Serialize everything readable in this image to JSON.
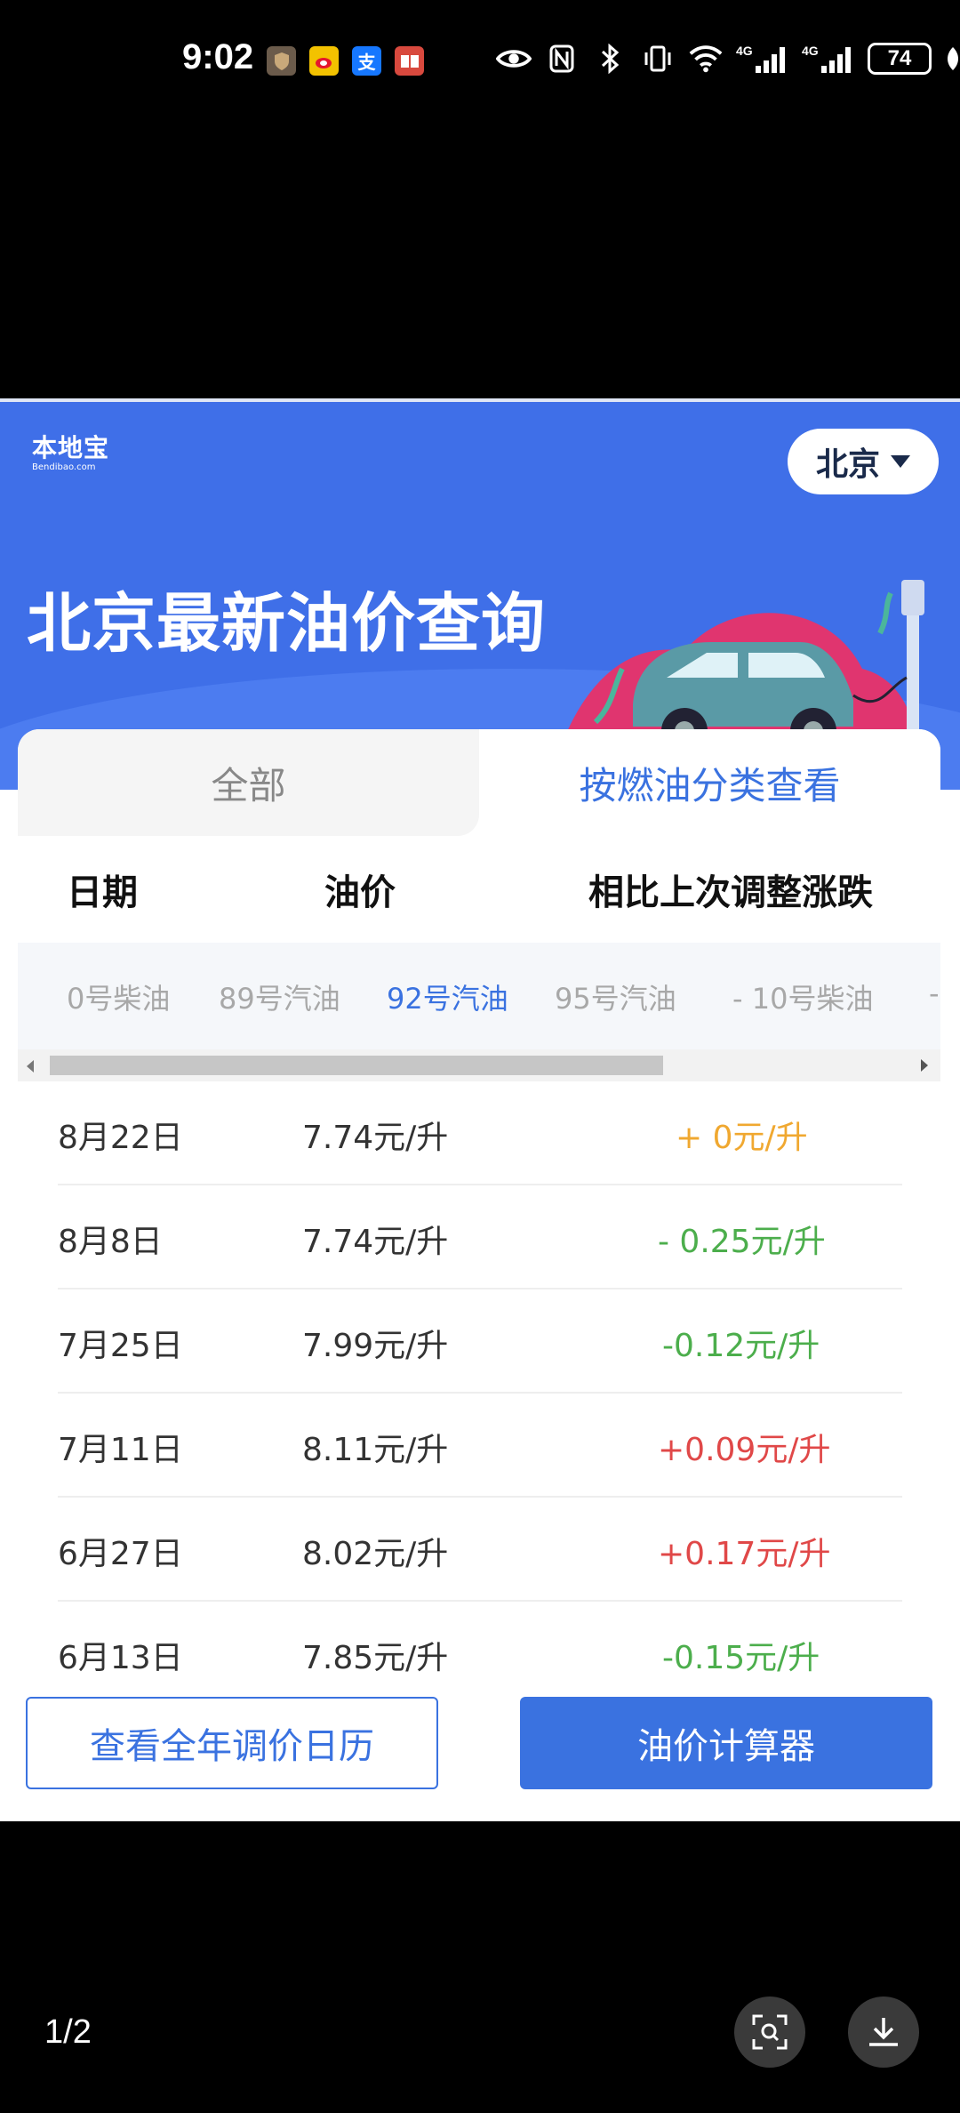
{
  "status_bar": {
    "time": "9:02",
    "battery": "74",
    "network": "4G"
  },
  "banner": {
    "logo_cn": "本地宝",
    "logo_en": "Bendibao.com",
    "city": "北京",
    "title": "北京最新油价查询"
  },
  "tabs": {
    "all": "全部",
    "by_fuel": "按燃油分类查看"
  },
  "table": {
    "headers": {
      "date": "日期",
      "price": "油价",
      "change": "相比上次调整涨跌"
    },
    "fuel_types": [
      "0号柴油",
      "89号汽油",
      "92号汽油",
      "95号汽油",
      "- 10号柴油",
      "-"
    ],
    "selected_fuel": "92号汽油",
    "rows": [
      {
        "date": "8月22日",
        "price": "7.74元/升",
        "change": "+ 0元/升",
        "trend": "flat"
      },
      {
        "date": "8月8日",
        "price": "7.74元/升",
        "change": "- 0.25元/升",
        "trend": "down"
      },
      {
        "date": "7月25日",
        "price": "7.99元/升",
        "change": "-0.12元/升",
        "trend": "down"
      },
      {
        "date": "7月11日",
        "price": "8.11元/升",
        "change": "+0.09元/升",
        "trend": "up"
      },
      {
        "date": "6月27日",
        "price": "8.02元/升",
        "change": "+0.17元/升",
        "trend": "up"
      },
      {
        "date": "6月13日",
        "price": "7.85元/升",
        "change": "-0.15元/升",
        "trend": "down"
      }
    ]
  },
  "buttons": {
    "calendar": "查看全年调价日历",
    "calculator": "油价计算器"
  },
  "viewer": {
    "page_counter": "1/2"
  },
  "colors": {
    "accent": "#3a72e0",
    "banner": "#3f6fe8",
    "up": "#e04848",
    "down": "#4cae4c",
    "flat": "#f0a830"
  }
}
